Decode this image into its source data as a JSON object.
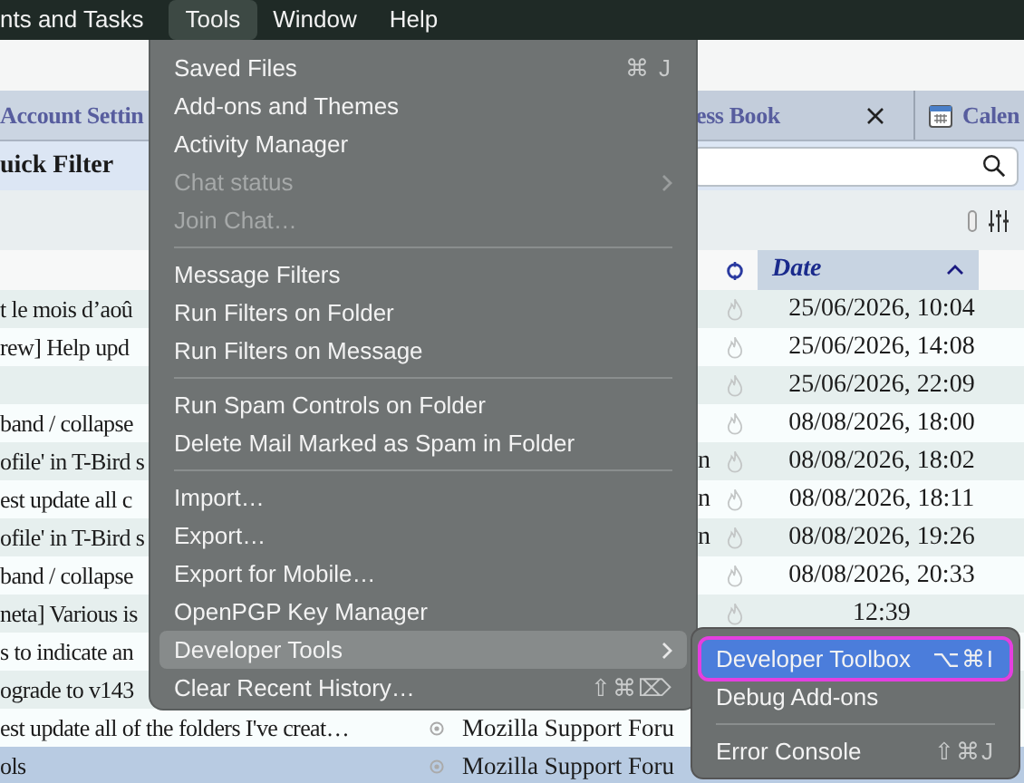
{
  "menubar": [
    {
      "label": "nts and Tasks",
      "selected": false
    },
    {
      "label": "Tools",
      "selected": true
    },
    {
      "label": "Window",
      "selected": false
    },
    {
      "label": "Help",
      "selected": false
    }
  ],
  "tabs": [
    {
      "label": "Account Settin",
      "kind": "plain"
    },
    {
      "label": "ess Book",
      "kind": "plain",
      "close": true
    },
    {
      "label": "Calen",
      "kind": "calendar"
    }
  ],
  "quick_filter": {
    "label": "uick Filter"
  },
  "columns": {
    "date": "Date"
  },
  "messages": [
    {
      "subject": "t le mois d’aoû",
      "date": "25/06/2026, 10:04",
      "selected": false
    },
    {
      "subject": "rew] Help upd",
      "date": "25/06/2026, 14:08",
      "selected": false
    },
    {
      "date": "25/06/2026, 22:09",
      "selected": false
    },
    {
      "subject": "band / collapse",
      "date": "08/08/2026, 18:00",
      "selected": false
    },
    {
      "subject": "ofile' in T-Bird s",
      "correspondent": "n",
      "date": "08/08/2026, 18:02",
      "selected": false
    },
    {
      "subject": "est update all c",
      "correspondent": "n",
      "date": "08/08/2026, 18:11",
      "selected": false
    },
    {
      "subject": "ofile' in T-Bird s",
      "correspondent": "n",
      "date": "08/08/2026, 19:26",
      "selected": false
    },
    {
      "subject": "band / collapse",
      "date": "08/08/2026, 20:33",
      "selected": false
    },
    {
      "subject": "neta] Various is",
      "date": "12:39",
      "selected": false
    },
    {
      "subject": "s to indicate an",
      "selected": false
    },
    {
      "subject": "ograde to v143",
      "selected": false
    },
    {
      "subject": "est update all of the folders I've creat…",
      "correspondent": "Mozilla Support Foru",
      "status_dot": true,
      "selected": false
    },
    {
      "subject": "ols",
      "correspondent": "Mozilla Support Foru",
      "status_dot": true,
      "selected": true
    }
  ],
  "menu": {
    "items": [
      {
        "kind": "item",
        "label": "Saved Files",
        "shortcut": "⌘ J",
        "submenu": false,
        "disabled": false,
        "selected": false
      },
      {
        "kind": "item",
        "label": "Add-ons and Themes",
        "submenu": false,
        "disabled": false,
        "selected": false
      },
      {
        "kind": "item",
        "label": "Activity Manager",
        "submenu": false,
        "disabled": false,
        "selected": false
      },
      {
        "kind": "item",
        "label": "Chat status",
        "submenu": true,
        "disabled": true,
        "selected": false
      },
      {
        "kind": "item",
        "label": "Join Chat…",
        "submenu": false,
        "disabled": true,
        "selected": false
      },
      {
        "kind": "separator"
      },
      {
        "kind": "item",
        "label": "Message Filters",
        "submenu": false,
        "disabled": false,
        "selected": false
      },
      {
        "kind": "item",
        "label": "Run Filters on Folder",
        "submenu": false,
        "disabled": false,
        "selected": false
      },
      {
        "kind": "item",
        "label": "Run Filters on Message",
        "submenu": false,
        "disabled": false,
        "selected": false
      },
      {
        "kind": "separator"
      },
      {
        "kind": "item",
        "label": "Run Spam Controls on Folder",
        "submenu": false,
        "disabled": false,
        "selected": false
      },
      {
        "kind": "item",
        "label": "Delete Mail Marked as Spam in Folder",
        "submenu": false,
        "disabled": false,
        "selected": false
      },
      {
        "kind": "separator"
      },
      {
        "kind": "item",
        "label": "Import…",
        "submenu": false,
        "disabled": false,
        "selected": false
      },
      {
        "kind": "item",
        "label": "Export…",
        "submenu": false,
        "disabled": false,
        "selected": false
      },
      {
        "kind": "item",
        "label": "Export for Mobile…",
        "submenu": false,
        "disabled": false,
        "selected": false
      },
      {
        "kind": "item",
        "label": "OpenPGP Key Manager",
        "submenu": false,
        "disabled": false,
        "selected": false
      },
      {
        "kind": "item",
        "label": "Developer Tools",
        "submenu": true,
        "disabled": false,
        "selected": true
      },
      {
        "kind": "item",
        "label": "Clear Recent History…",
        "shortcut": "⇧⌘⌦",
        "submenu": false,
        "disabled": false,
        "selected": false
      }
    ]
  },
  "submenu": {
    "items": [
      {
        "kind": "item",
        "label": "Developer Toolbox",
        "shortcut": "⌥⌘I",
        "selected": true
      },
      {
        "kind": "item",
        "label": "Debug Add-ons",
        "selected": false
      },
      {
        "kind": "separator"
      },
      {
        "kind": "item",
        "label": "Error Console",
        "shortcut": "⇧⌘J",
        "selected": false
      }
    ]
  }
}
